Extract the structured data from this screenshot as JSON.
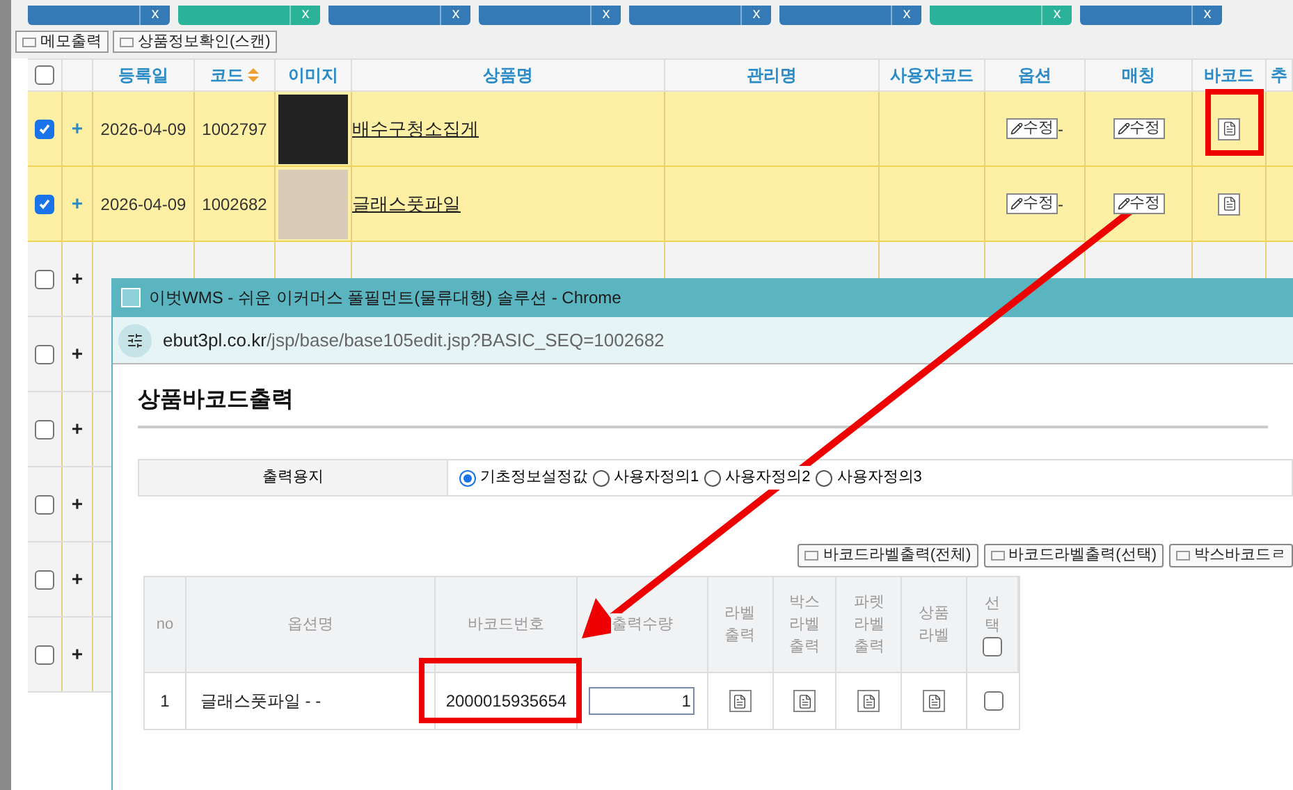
{
  "top_tabs": [
    {
      "color": "#337ab7",
      "close": "x"
    },
    {
      "color": "#2bb39a",
      "close": "x"
    },
    {
      "color": "#337ab7",
      "close": "x"
    },
    {
      "color": "#337ab7",
      "close": "x"
    },
    {
      "color": "#337ab7",
      "close": "x"
    },
    {
      "color": "#337ab7",
      "close": "x"
    },
    {
      "color": "#2bb39a",
      "close": "x"
    },
    {
      "color": "#337ab7",
      "close": "x"
    }
  ],
  "toolbar_buttons": [
    "메모출력",
    "상품정보확인(스캔)"
  ],
  "table": {
    "select_all": false,
    "columns": [
      "등록일",
      "코드",
      "이미지",
      "상품명",
      "관리명",
      "사용자코드",
      "옵션",
      "매칭",
      "바코드",
      "추"
    ],
    "rows": [
      {
        "checked": true,
        "expand": "+",
        "date": "2026-04-09",
        "code": "1002797",
        "name": "배수구청소집게",
        "option_edit": "수정",
        "option_suffix": "-",
        "matching_edit": "수정"
      },
      {
        "checked": true,
        "expand": "+",
        "date": "2026-04-09",
        "code": "1002682",
        "name": "글래스풋파일",
        "option_edit": "수정",
        "option_suffix": "-",
        "matching_edit": "수정"
      },
      {
        "checked": false,
        "expand": "+"
      },
      {
        "checked": false,
        "expand": "+"
      },
      {
        "checked": false,
        "expand": "+"
      },
      {
        "checked": false,
        "expand": "+"
      },
      {
        "checked": false,
        "expand": "+"
      },
      {
        "checked": false,
        "expand": "+"
      }
    ]
  },
  "popup": {
    "window_title": "이벗WMS - 쉬운 이커머스 풀필먼트(물류대행) 솔루션 - Chrome",
    "url_host": "ebut3pl.co.kr",
    "url_path": "/jsp/base/base105edit.jsp?BASIC_SEQ=1002682",
    "heading": "상품바코드출력",
    "paper": {
      "label": "출력용지",
      "options": [
        {
          "label": "기초정보설정값",
          "selected": true
        },
        {
          "label": "사용자정의1",
          "selected": false
        },
        {
          "label": "사용자정의2",
          "selected": false
        },
        {
          "label": "사용자정의3",
          "selected": false
        }
      ]
    },
    "buttons": [
      "바코드라벨출력(전체)",
      "바코드라벨출력(선택)",
      "박스바코드ㄹ"
    ],
    "table": {
      "columns": [
        "no",
        "옵션명",
        "바코드번호",
        "출력수량",
        "라벨\n출력",
        "박스\n라벨\n출력",
        "파렛\n라벨\n출력",
        "상품\n라벨",
        "선\n택"
      ],
      "select_all": false,
      "rows": [
        {
          "no": "1",
          "option_name": "글래스풋파일 - -",
          "barcode": "2000015935654",
          "quantity": "1",
          "selected": false
        }
      ]
    }
  }
}
